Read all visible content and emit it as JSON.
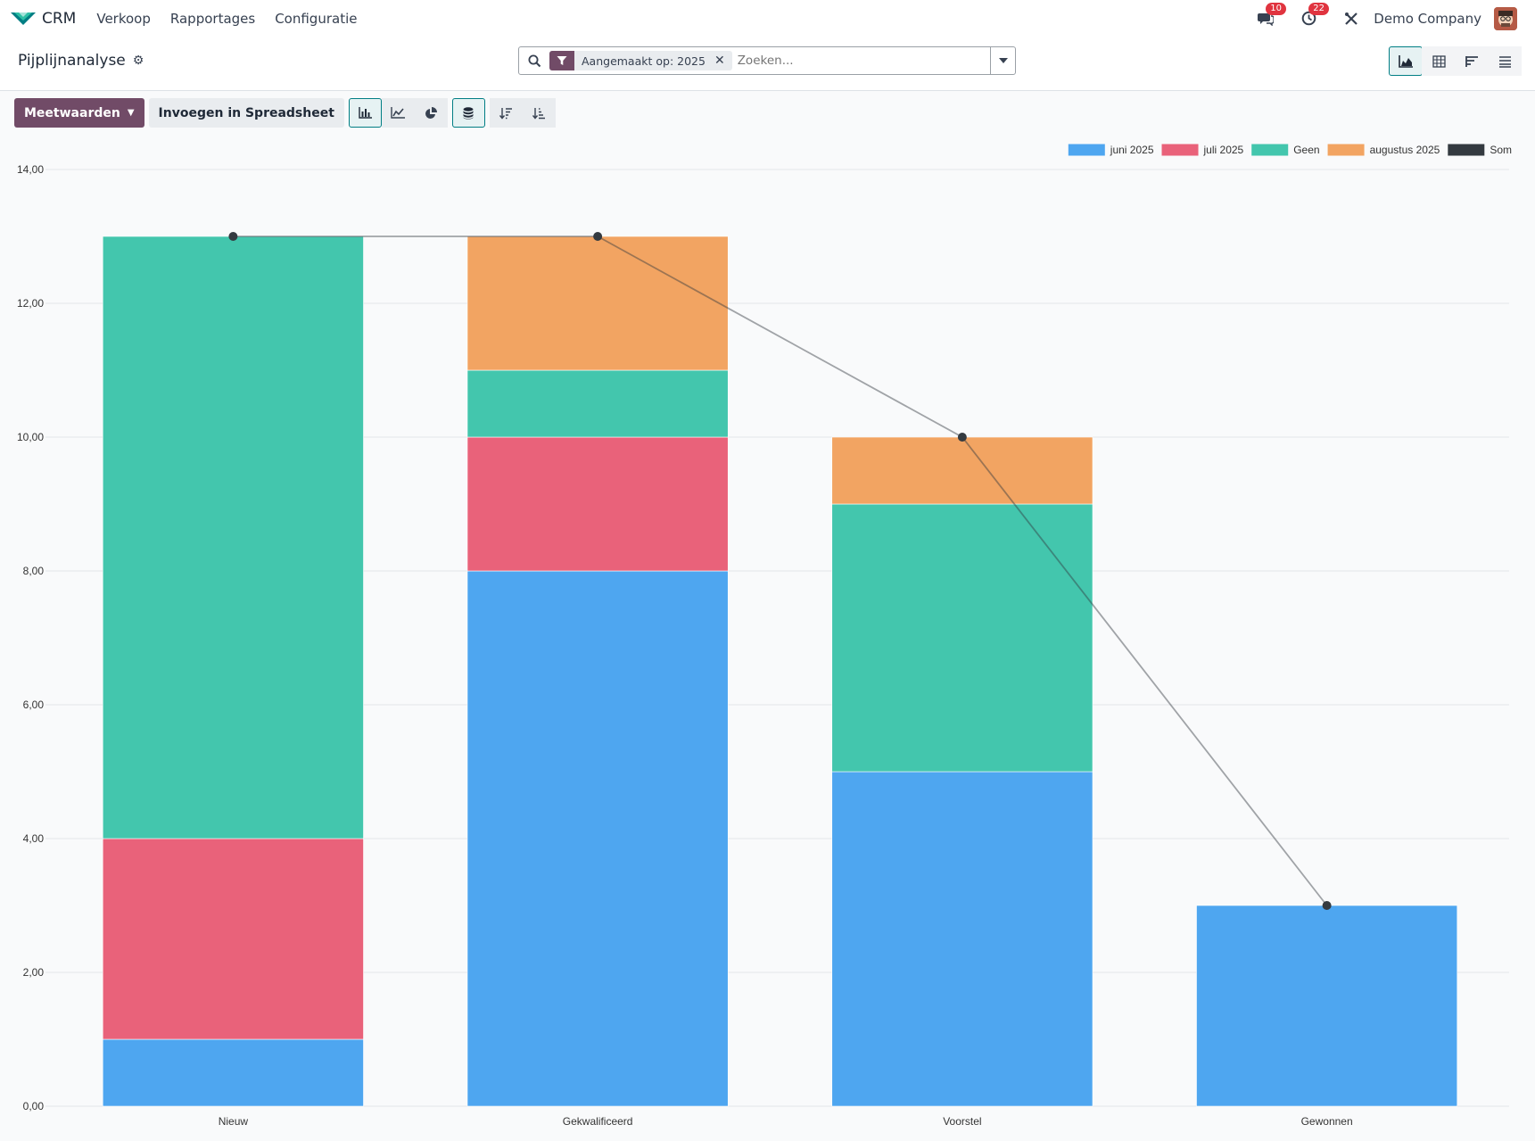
{
  "navbar": {
    "app_name": "CRM",
    "menu": [
      "Verkoop",
      "Rapportages",
      "Configuratie"
    ],
    "messages_count": "10",
    "activities_count": "22",
    "company": "Demo Company"
  },
  "control_panel": {
    "title": "Pijplijnanalyse",
    "facet": "Aangemaakt op: 2025",
    "search_placeholder": "Zoeken..."
  },
  "toolbar": {
    "measures_label": "Meetwaarden",
    "insert_label": "Invoegen in Spreadsheet"
  },
  "colors": {
    "brand": "#714b67",
    "accent": "#017e84",
    "juni": "#4ea6f0",
    "juli": "#e9627a",
    "geen": "#43c6ad",
    "augustus": "#f2a462",
    "som": "#343a40"
  },
  "chart_data": {
    "type": "bar",
    "stacked": true,
    "categories": [
      "Nieuw",
      "Gekwalificeerd",
      "Voorstel",
      "Gewonnen"
    ],
    "series": [
      {
        "name": "juni 2025",
        "values": [
          1,
          8,
          5,
          3
        ]
      },
      {
        "name": "juli 2025",
        "values": [
          3,
          2,
          0,
          0
        ]
      },
      {
        "name": "Geen",
        "values": [
          9,
          1,
          4,
          0
        ]
      },
      {
        "name": "augustus 2025",
        "values": [
          0,
          2,
          1,
          0
        ]
      }
    ],
    "sum_line": {
      "name": "Som",
      "values": [
        13,
        13,
        10,
        3
      ]
    },
    "ylim": [
      0,
      14
    ],
    "yticks": [
      "0,00",
      "2,00",
      "4,00",
      "6,00",
      "8,00",
      "10,00",
      "12,00",
      "14,00"
    ],
    "grid": true,
    "legend_position": "top-right"
  }
}
